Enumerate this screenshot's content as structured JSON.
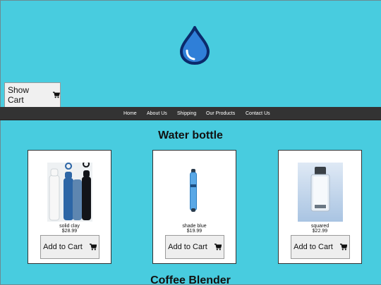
{
  "header": {
    "logo_icon": "water-drop-icon",
    "show_cart_label": "Show Cart",
    "cart_icon": "cart-icon"
  },
  "nav": {
    "items": [
      {
        "label": "Home"
      },
      {
        "label": "About Us"
      },
      {
        "label": "Shipping"
      },
      {
        "label": "Our Products"
      },
      {
        "label": "Contact Us"
      }
    ]
  },
  "sections": [
    {
      "title": "Water bottle",
      "products": [
        {
          "name": "solid clay",
          "price": "$28.99",
          "add_label": "Add to Cart"
        },
        {
          "name": "shade blue",
          "price": "$19.99",
          "add_label": "Add to Cart"
        },
        {
          "name": "squared",
          "price": "$22.99",
          "add_label": "Add to Cart"
        }
      ]
    },
    {
      "title": "Coffee Blender"
    }
  ],
  "colors": {
    "background": "#48ccdf",
    "navbar": "#333333",
    "drop_fill": "#2f7fd8",
    "drop_outline": "#0b2a6b"
  }
}
